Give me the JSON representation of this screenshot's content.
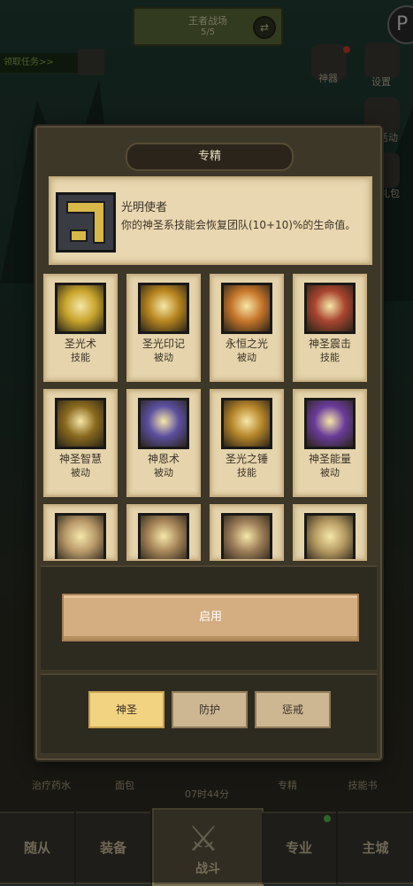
{
  "background": {
    "battle_banner": {
      "line1": "王者战场",
      "line2": "5/5"
    },
    "quest_tag": "领取任务>>",
    "right_icons": [
      {
        "name": "artifact",
        "label": "神器"
      },
      {
        "name": "settings",
        "label": "设置"
      },
      {
        "name": "event",
        "label": "活动"
      },
      {
        "name": "gift",
        "label": "礼包"
      }
    ],
    "utility": {
      "potion": "治疗药水",
      "bread": "面包",
      "timer": "07时44分",
      "specialization": "专精",
      "skill_book": "技能书"
    },
    "nav": {
      "followers": "随从",
      "equipment": "装备",
      "fight": "战斗",
      "profession": "专业",
      "main_city": "主城"
    }
  },
  "modal": {
    "title": "专精",
    "selected": {
      "name": "光明使者",
      "description": "你的神圣系技能会恢复团队(10+10)%的生命值。"
    },
    "skills": [
      {
        "name": "圣光术",
        "type": "技能",
        "icon": "holy-light-icon",
        "color": "#c9a52c"
      },
      {
        "name": "圣光印记",
        "type": "被动",
        "icon": "holy-mark-icon",
        "color": "#b8861f"
      },
      {
        "name": "永恒之光",
        "type": "被动",
        "icon": "eternal-light-icon",
        "color": "#c7762a"
      },
      {
        "name": "神圣震击",
        "type": "技能",
        "icon": "holy-shock-icon",
        "color": "#a9452f"
      },
      {
        "name": "神圣智慧",
        "type": "被动",
        "icon": "divine-wisdom-icon",
        "color": "#8a6a1e"
      },
      {
        "name": "神恩术",
        "type": "被动",
        "icon": "divine-favor-icon",
        "color": "#5b4fa0"
      },
      {
        "name": "圣光之锤",
        "type": "技能",
        "icon": "hammer-of-light-icon",
        "color": "#b7862a"
      },
      {
        "name": "神圣能量",
        "type": "被动",
        "icon": "holy-power-icon",
        "color": "#6a3c9a"
      },
      {
        "name": "",
        "type": "",
        "icon": "locked-skill-icon",
        "color": "#b99a6a"
      },
      {
        "name": "",
        "type": "",
        "icon": "locked-skill-icon",
        "color": "#a7865a"
      },
      {
        "name": "",
        "type": "",
        "icon": "locked-skill-icon",
        "color": "#9c7d58"
      },
      {
        "name": "",
        "type": "",
        "icon": "locked-skill-icon",
        "color": "#b59a62"
      }
    ],
    "activate_label": "启用",
    "tabs": [
      {
        "label": "神圣",
        "active": true
      },
      {
        "label": "防护",
        "active": false
      },
      {
        "label": "惩戒",
        "active": false
      }
    ]
  }
}
